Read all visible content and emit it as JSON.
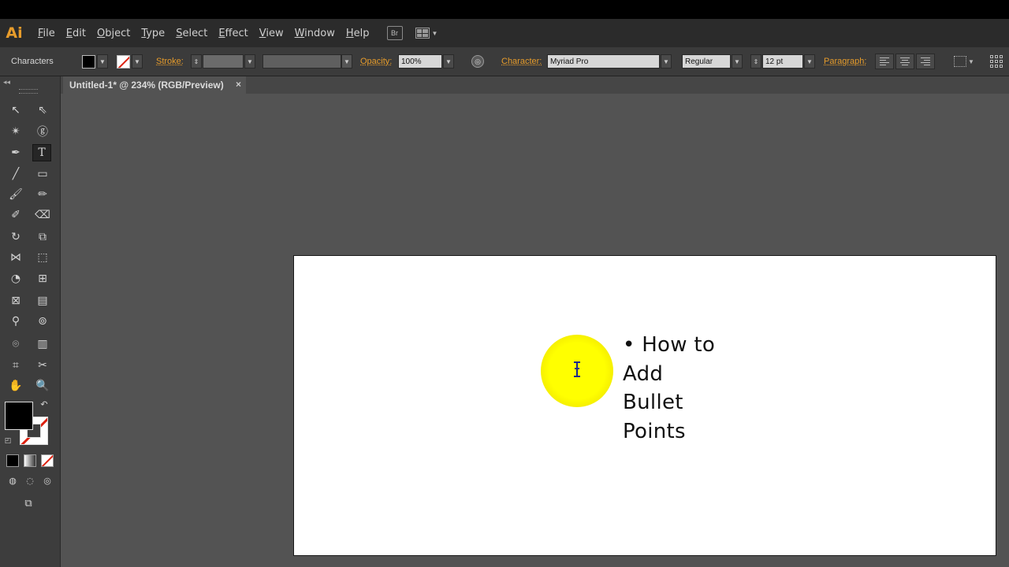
{
  "app": {
    "logo": "Ai"
  },
  "menubar": {
    "items": [
      "File",
      "Edit",
      "Object",
      "Type",
      "Select",
      "Effect",
      "View",
      "Window",
      "Help"
    ],
    "bridge_icon": "Br"
  },
  "controlbar": {
    "panel_label": "Characters",
    "stroke_label": "Stroke:",
    "opacity_label": "Opacity:",
    "opacity_value": "100%",
    "character_label": "Character:",
    "font_family": "Myriad Pro",
    "font_style": "Regular",
    "font_size": "12 pt",
    "paragraph_label": "Paragraph:",
    "fill_color": "#000000",
    "stroke_color": "none"
  },
  "document": {
    "tab_title": "Untitled-1* @ 234% (RGB/Preview)",
    "close_icon": "×"
  },
  "canvas": {
    "text_lines": [
      "• How to",
      "Add",
      "Bullet",
      "Points"
    ],
    "highlight_color": "#ffff00"
  },
  "toolbox": {
    "collapse": "◂◂",
    "fill_color": "#000000",
    "stroke_color": "none"
  }
}
